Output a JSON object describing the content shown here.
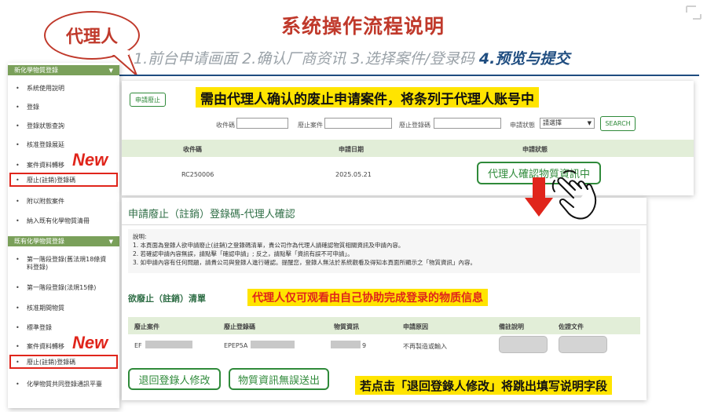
{
  "header": {
    "title": "系统操作流程说明",
    "role_bubble": "代理人",
    "steps_prefix": "1.前台申请画面 2.确认厂商资讯 3.选择案件/登录码 ",
    "steps_current": "4.预览与提交"
  },
  "sidebar": {
    "section1_title": "新化學物質登錄",
    "section1_items": [
      "系統使用說明",
      "登錄",
      "登錄狀態查詢",
      "核准登錄展延",
      "案件資料轉移",
      "廢止(註銷)登錄碼",
      "附以附款案件",
      "納入既有化學物質清冊"
    ],
    "section2_title": "既有化學物質登錄",
    "section2_items": [
      "第一階段登錄(舊法規18條資料登錄)",
      "第一階段登錄(法規15條)",
      "核准期間物質",
      "標準登錄",
      "案件資料轉移",
      "廢止(註銷)登錄碼",
      "化學物質共同登錄通訊平臺"
    ],
    "new_badge": "New"
  },
  "top_panel": {
    "apply_button": "申請廢止",
    "banner": "需由代理人确认的废止申请案件，将条列于代理人账号中",
    "filters": {
      "receipt_label": "收件碼",
      "case_label": "廢止案件",
      "reg_code_label": "廢止登錄碼",
      "status_label": "申請狀態",
      "status_value": "請選擇",
      "search_button": "SEARCH"
    },
    "table": {
      "headers": [
        "收件碼",
        "申請日期",
        "申請狀態"
      ],
      "row": {
        "receipt": "RC250006",
        "date": "2025.05.21",
        "status": "代理人確認物質資訊中"
      }
    }
  },
  "bottom_panel": {
    "title": "申請廢止（註銷）登錄碼-代理人確認",
    "notes": [
      "說明:",
      "1. 本頁面為登錄人欲申請廢止(註銷)之登錄碼清單，貴公司作為代理人請確認物質相關資訊及申請內容。",
      "2. 若確認申請內容無誤，請點擊「確認申請」; 反之，請點擊「資訊有誤不可申請」。",
      "3. 如申請內容有任何問題，請貴公司與登錄人進行確認。提醒您，登錄人無法於系統觀看及得知本頁面所顯示之「物質資訊」內容。"
    ],
    "list_title": "欲廢止（註銷）清單",
    "banner": "代理人仅可观看由自己协助完成登录的物质信息",
    "table": {
      "headers": [
        "廢止案件",
        "廢止登錄碼",
        "物質資訊",
        "申請原因",
        "備註說明",
        "佐證文件"
      ],
      "row": {
        "case": "EF",
        "reg_code": "EPEP5A",
        "substance_tail": "9",
        "reason": "不再製造或輸入"
      }
    },
    "return_button": "退回登錄人修改",
    "confirm_button": "物質資訊無誤送出"
  },
  "bottom_banner": "若点击「退回登錄人修改」将跳出填写说明字段",
  "colors": {
    "title_red": "#c0392b",
    "accent_green": "#2f8a3a",
    "highlight_yellow": "#ffe400",
    "alert_red": "#e0251b",
    "sidebar_green": "#7aa05a"
  }
}
